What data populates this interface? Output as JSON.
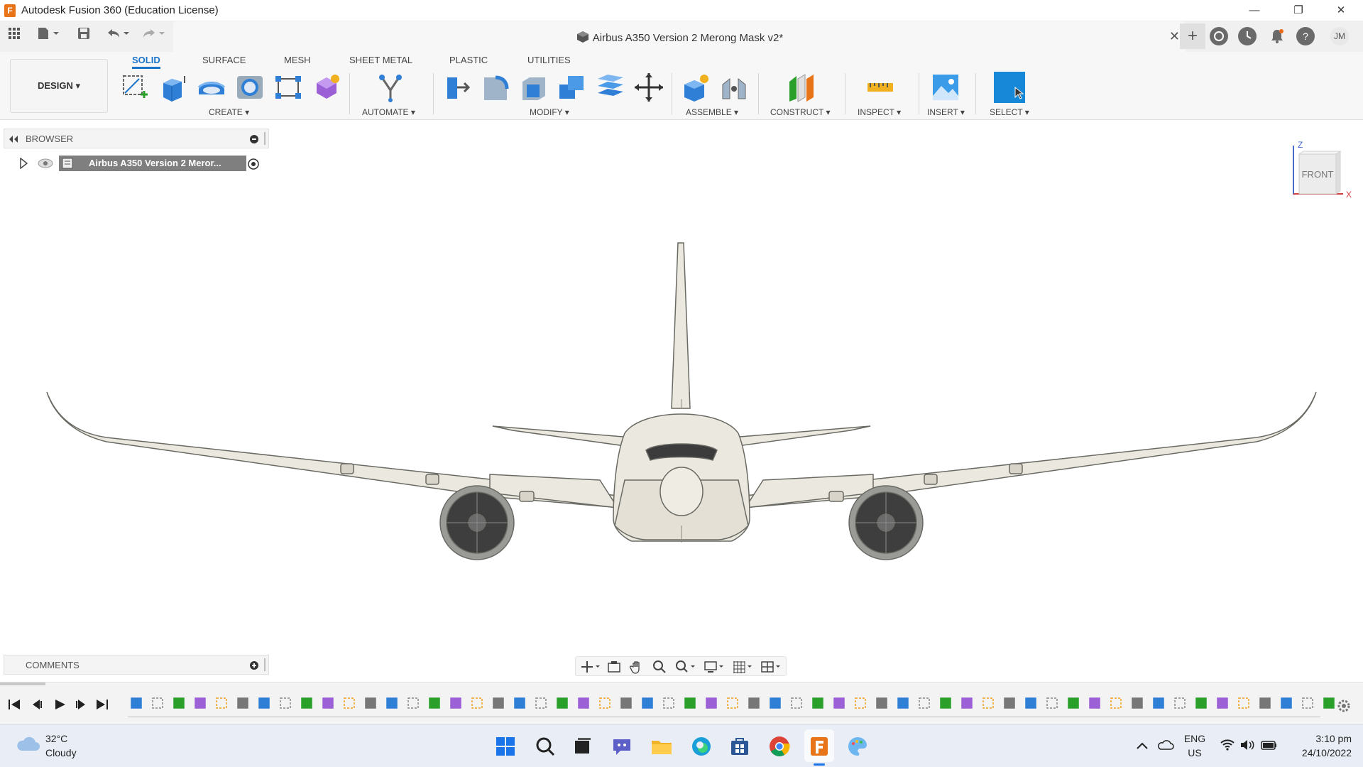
{
  "window": {
    "title": "Autodesk Fusion 360 (Education License)",
    "controls": {
      "minimize": "—",
      "restore": "❐",
      "close": "✕"
    }
  },
  "document": {
    "tab_title": "Airbus A350 Version 2 Merong Mask v2*",
    "close": "✕"
  },
  "user": {
    "initials": "JM"
  },
  "ribbon": {
    "workspace": "DESIGN ▾",
    "tabs": [
      {
        "label": "SOLID",
        "active": true
      },
      {
        "label": "SURFACE"
      },
      {
        "label": "MESH"
      },
      {
        "label": "SHEET METAL"
      },
      {
        "label": "PLASTIC"
      },
      {
        "label": "UTILITIES"
      }
    ],
    "groups": {
      "create": "CREATE ▾",
      "automate": "AUTOMATE ▾",
      "modify": "MODIFY ▾",
      "assemble": "ASSEMBLE ▾",
      "construct": "CONSTRUCT ▾",
      "inspect": "INSPECT ▾",
      "insert": "INSERT ▾",
      "select": "SELECT ▾"
    }
  },
  "browser": {
    "title": "BROWSER",
    "root_item": "Airbus A350 Version 2 Meror..."
  },
  "comments": {
    "title": "COMMENTS"
  },
  "viewcube": {
    "face": "FRONT",
    "axis_z": "Z",
    "axis_x": "X"
  },
  "taskbar": {
    "weather_temp": "32°C",
    "weather_desc": "Cloudy",
    "lang_top": "ENG",
    "lang_bottom": "US",
    "time": "3:10 pm",
    "date": "24/10/2022"
  },
  "colors": {
    "accent": "#1a73c9",
    "select_tool": "#1787d8",
    "aircraft_body": "#ebe8df",
    "aircraft_outline": "#6a6a64"
  }
}
